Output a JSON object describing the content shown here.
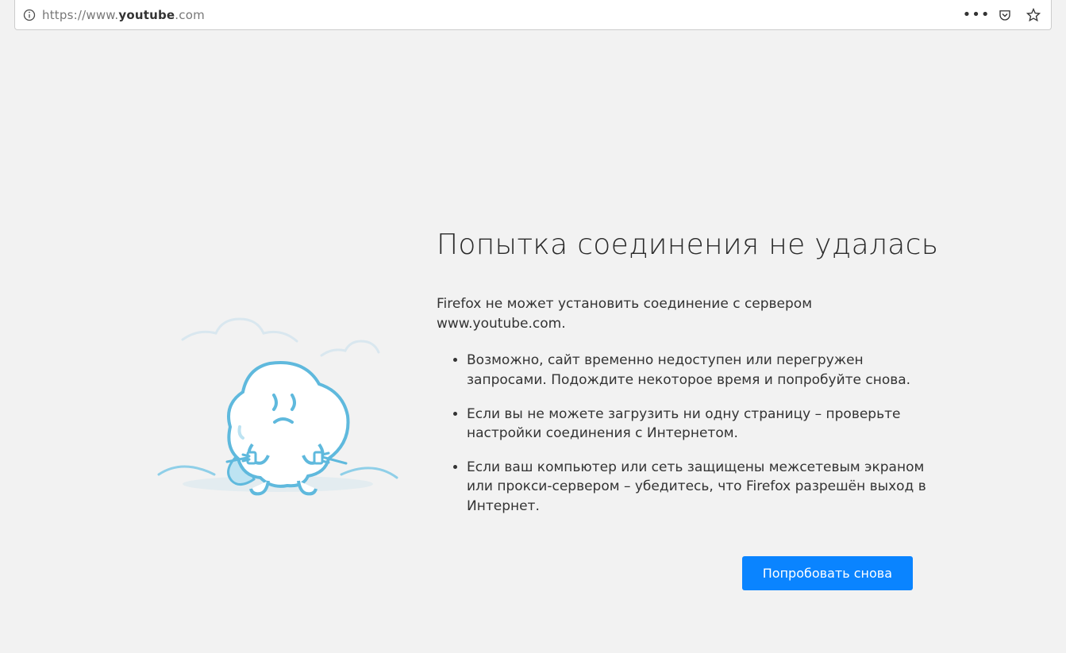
{
  "urlbar": {
    "scheme": "https://www.",
    "host": "youtube",
    "tld": ".com"
  },
  "error": {
    "title": "Попытка соединения не удалась",
    "description": "Firefox не может установить соединение с сервером www.youtube.com.",
    "bullets": [
      "Возможно, сайт временно недоступен или перегружен запросами. Подождите некоторое время и попробуйте снова.",
      "Если вы не можете загрузить ни одну страницу – проверьте настройки соединения с Интернетом.",
      "Если ваш компьютер или сеть защищены межсетевым экраном или прокси-сервером – убедитесь, что Firefox разрешён выход в Интернет."
    ],
    "retry_label": "Попробовать снова"
  }
}
